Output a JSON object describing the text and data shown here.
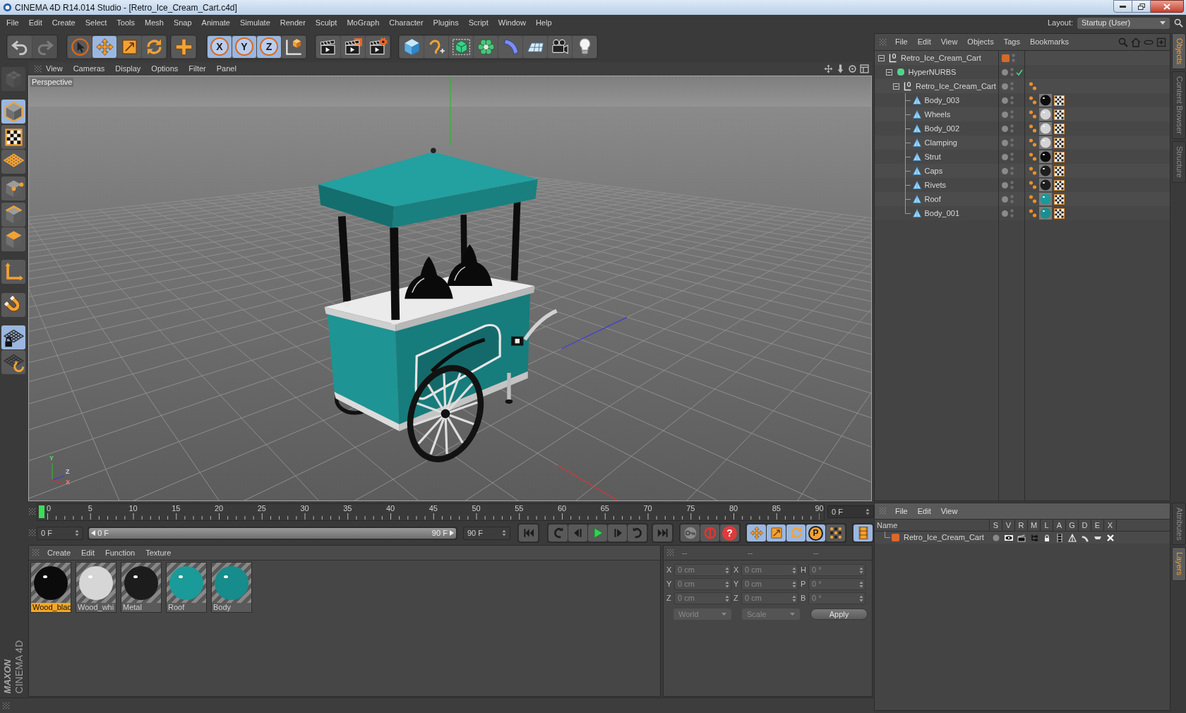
{
  "window": {
    "title": "CINEMA 4D R14.014 Studio - [Retro_Ice_Cream_Cart.c4d]"
  },
  "menu_bar": [
    "File",
    "Edit",
    "Create",
    "Select",
    "Tools",
    "Mesh",
    "Snap",
    "Animate",
    "Simulate",
    "Render",
    "Sculpt",
    "MoGraph",
    "Character",
    "Plugins",
    "Script",
    "Window",
    "Help"
  ],
  "layout": {
    "label": "Layout:",
    "value": "Startup (User)"
  },
  "toolbar": [
    {
      "tools": [
        {
          "kind": "undo",
          "selected": false,
          "disabled": false
        },
        {
          "kind": "redo",
          "selected": false,
          "disabled": true
        }
      ]
    },
    {
      "tools": [
        {
          "kind": "select",
          "selected": false,
          "disabled": false
        },
        {
          "kind": "move",
          "selected": true,
          "disabled": false
        },
        {
          "kind": "scale",
          "selected": false,
          "disabled": false
        },
        {
          "kind": "rotate",
          "selected": false,
          "disabled": false
        }
      ]
    },
    {
      "tools": [
        {
          "kind": "recent",
          "selected": false,
          "disabled": false
        }
      ]
    },
    {
      "tools": [
        {
          "kind": "axis",
          "label": "X",
          "selected": true,
          "disabled": false
        },
        {
          "kind": "axis",
          "label": "Y",
          "selected": true,
          "disabled": false
        },
        {
          "kind": "axis",
          "label": "Z",
          "selected": true,
          "disabled": false
        },
        {
          "kind": "coords",
          "selected": false,
          "disabled": false
        }
      ]
    },
    {
      "tools": [
        {
          "kind": "render_view",
          "selected": false,
          "disabled": false
        },
        {
          "kind": "render_viewer",
          "selected": false,
          "disabled": false
        },
        {
          "kind": "render_settings",
          "selected": false,
          "disabled": false
        }
      ]
    },
    {
      "tools": [
        {
          "kind": "cube",
          "selected": false,
          "disabled": false
        },
        {
          "kind": "pen",
          "selected": false,
          "disabled": false
        },
        {
          "kind": "subdivision",
          "selected": false,
          "disabled": false
        },
        {
          "kind": "cloner",
          "selected": false,
          "disabled": false
        },
        {
          "kind": "deformer",
          "selected": false,
          "disabled": false
        },
        {
          "kind": "floor",
          "selected": false,
          "disabled": false
        },
        {
          "kind": "camera",
          "selected": false,
          "disabled": false
        },
        {
          "kind": "light",
          "selected": false,
          "disabled": false
        }
      ]
    }
  ],
  "mode_toolbar": [
    {
      "kind": "make_editable",
      "selected": false,
      "disabled": true
    },
    {
      "kind": "model",
      "selected": true,
      "disabled": false
    },
    {
      "kind": "texture",
      "selected": false,
      "disabled": false
    },
    {
      "kind": "workplane",
      "selected": false,
      "disabled": false
    },
    {
      "kind": "points",
      "selected": false,
      "disabled": false
    },
    {
      "kind": "edges",
      "selected": false,
      "disabled": false
    },
    {
      "kind": "polygons",
      "selected": false,
      "disabled": false
    },
    {
      "kind": "axis_mode",
      "selected": false,
      "disabled": false
    },
    {
      "kind": "magnet",
      "selected": false,
      "disabled": false
    },
    {
      "kind": "locked_workplane",
      "selected": true,
      "disabled": false
    },
    {
      "kind": "planar_workplane",
      "selected": false,
      "disabled": false
    }
  ],
  "logo": {
    "brand": "MAXON",
    "product": "CINEMA 4D"
  },
  "viewport": {
    "menu": [
      "View",
      "Cameras",
      "Display",
      "Options",
      "Filter",
      "Panel"
    ],
    "camera": "Perspective",
    "gizmo_labels": [
      "Y",
      "Z",
      "X"
    ]
  },
  "timeline": {
    "ticks": [
      "0",
      "5",
      "10",
      "15",
      "20",
      "25",
      "30",
      "35",
      "40",
      "45",
      "50",
      "55",
      "60",
      "65",
      "70",
      "75",
      "80",
      "85",
      "90"
    ],
    "playhead": {
      "level": 0
    },
    "current_frame": "0 F"
  },
  "playback": {
    "start": "0 F",
    "range_start": "0 F",
    "range_end": "90 F",
    "range_bar": {
      "level": 1
    },
    "end": "90 F",
    "groups": [
      {
        "controls": [
          {
            "kind": "goto_start",
            "selected": false
          }
        ]
      },
      {
        "controls": [
          {
            "kind": "prev_key",
            "selected": false
          },
          {
            "kind": "prev_frame",
            "selected": false
          },
          {
            "kind": "play",
            "selected": false
          },
          {
            "kind": "next_frame",
            "selected": false
          },
          {
            "kind": "next_key",
            "selected": false
          }
        ]
      },
      {
        "controls": [
          {
            "kind": "goto_end",
            "selected": false
          }
        ]
      },
      {
        "controls": [
          {
            "kind": "record",
            "selected": false
          },
          {
            "kind": "autokey",
            "selected": false
          },
          {
            "kind": "help",
            "label": "?",
            "selected": false
          }
        ]
      },
      {
        "controls": [
          {
            "kind": "key_position",
            "selected": true
          },
          {
            "kind": "key_scale",
            "selected": true
          },
          {
            "kind": "key_rotation",
            "selected": true
          },
          {
            "kind": "key_parameter",
            "label": "P",
            "selected": true
          },
          {
            "kind": "key_points",
            "selected": false
          }
        ]
      },
      {
        "controls": [
          {
            "kind": "timeline",
            "selected": true
          }
        ]
      }
    ]
  },
  "material_manager": {
    "menu": [
      "Create",
      "Edit",
      "Function",
      "Texture"
    ],
    "materials": [
      {
        "name": "Wood_blac",
        "selected": true,
        "color": "#0b0b0b"
      },
      {
        "name": "Wood_whi",
        "selected": false,
        "color": "#d6d6d6"
      },
      {
        "name": "Metal",
        "selected": false,
        "color": "#1c1c1c"
      },
      {
        "name": "Roof",
        "selected": false,
        "color": "#1b9a9a"
      },
      {
        "name": "Body",
        "selected": false,
        "color": "#168c8c"
      }
    ]
  },
  "coordinates": {
    "headers": [
      "--",
      "--",
      "--"
    ],
    "disabled": true,
    "rows": [
      {
        "fields": [
          {
            "axis": "X",
            "value": "0 cm"
          },
          {
            "axis": "X",
            "value": "0 cm"
          },
          {
            "axis": "H",
            "value": "0 °"
          }
        ]
      },
      {
        "fields": [
          {
            "axis": "Y",
            "value": "0 cm"
          },
          {
            "axis": "Y",
            "value": "0 cm"
          },
          {
            "axis": "P",
            "value": "0 °"
          }
        ]
      },
      {
        "fields": [
          {
            "axis": "Z",
            "value": "0 cm"
          },
          {
            "axis": "Z",
            "value": "0 cm"
          },
          {
            "axis": "B",
            "value": "0 °"
          }
        ]
      }
    ],
    "dropdowns": [
      "World",
      "Scale"
    ],
    "apply": "Apply"
  },
  "object_manager": {
    "menu": [
      "File",
      "Edit",
      "View",
      "Objects",
      "Tags",
      "Bookmarks"
    ],
    "objects": [
      {
        "name": "Retro_Ice_Cream_Cart",
        "kind": "null",
        "color": "#d8692a",
        "expanded": true,
        "children": [
          {
            "name": "HyperNURBS",
            "kind": "generator",
            "enabled": true,
            "expanded": true,
            "children": [
              {
                "name": "Retro_Ice_Cream_Cart",
                "kind": "null",
                "expanded": true,
                "tags": [
                  {
                    "kind": "phong"
                  }
                ],
                "children": [
                  {
                    "name": "Body_003",
                    "kind": "polygon",
                    "tags": [
                      {
                        "kind": "phong"
                      },
                      {
                        "kind": "texture",
                        "color": "#0c0c0c"
                      },
                      {
                        "kind": "uvw"
                      }
                    ]
                  },
                  {
                    "name": "Wheels",
                    "kind": "polygon",
                    "tags": [
                      {
                        "kind": "phong"
                      },
                      {
                        "kind": "texture",
                        "color": "#d4d4d4"
                      },
                      {
                        "kind": "uvw"
                      }
                    ]
                  },
                  {
                    "name": "Body_002",
                    "kind": "polygon",
                    "tags": [
                      {
                        "kind": "phong"
                      },
                      {
                        "kind": "texture",
                        "color": "#d4d4d4"
                      },
                      {
                        "kind": "uvw"
                      }
                    ]
                  },
                  {
                    "name": "Clamping",
                    "kind": "polygon",
                    "tags": [
                      {
                        "kind": "phong"
                      },
                      {
                        "kind": "texture",
                        "color": "#d4d4d4"
                      },
                      {
                        "kind": "uvw"
                      }
                    ]
                  },
                  {
                    "name": "Strut",
                    "kind": "polygon",
                    "tags": [
                      {
                        "kind": "phong"
                      },
                      {
                        "kind": "texture",
                        "color": "#0c0c0c"
                      },
                      {
                        "kind": "uvw"
                      }
                    ]
                  },
                  {
                    "name": "Caps",
                    "kind": "polygon",
                    "tags": [
                      {
                        "kind": "phong"
                      },
                      {
                        "kind": "texture",
                        "color": "#1e1e1e"
                      },
                      {
                        "kind": "uvw"
                      }
                    ]
                  },
                  {
                    "name": "Rivets",
                    "kind": "polygon",
                    "tags": [
                      {
                        "kind": "phong"
                      },
                      {
                        "kind": "texture",
                        "color": "#1e1e1e"
                      },
                      {
                        "kind": "uvw"
                      }
                    ]
                  },
                  {
                    "name": "Roof",
                    "kind": "polygon",
                    "tags": [
                      {
                        "kind": "phong"
                      },
                      {
                        "kind": "texture",
                        "color": "#1a9a9a"
                      },
                      {
                        "kind": "uvw"
                      }
                    ]
                  },
                  {
                    "name": "Body_001",
                    "kind": "polygon",
                    "tags": [
                      {
                        "kind": "phong"
                      },
                      {
                        "kind": "texture",
                        "color": "#188f8f"
                      },
                      {
                        "kind": "uvw"
                      }
                    ]
                  }
                ]
              }
            ]
          }
        ]
      }
    ]
  },
  "layer_manager": {
    "menu": [
      "File",
      "Edit",
      "View"
    ],
    "columns": [
      "Name",
      "S",
      "V",
      "R",
      "M",
      "L",
      "A",
      "G",
      "D",
      "E",
      "X"
    ],
    "layers": [
      {
        "name": "Retro_Ice_Cream_Cart",
        "color": "#d8692a"
      }
    ]
  },
  "side_tabs_top": [
    {
      "label": "Objects",
      "selected": true
    },
    {
      "label": "Content Browser",
      "selected": false
    },
    {
      "label": "Structure",
      "selected": false
    }
  ],
  "side_tabs_bottom": [
    {
      "label": "Attributes",
      "selected": false
    },
    {
      "label": "Layers",
      "selected": true
    }
  ]
}
